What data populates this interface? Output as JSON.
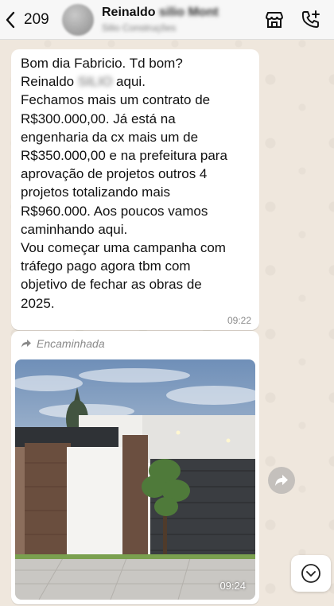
{
  "header": {
    "back_count": "209",
    "contact_name": "Reinaldo",
    "contact_name_hidden": "silio Mont",
    "contact_subtitle_hidden": "Silio Construções",
    "icons": [
      "chevron-left-icon",
      "store-icon",
      "add-call-icon"
    ]
  },
  "message": {
    "lines": [
      "Bom dia Fabricio. Td bom?",
      "Reinaldo",
      "Fechamos mais um contrato de",
      "R$300.000,00. Já está na",
      "engenharia da cx mais um de",
      "R$350.000,00 e na prefeitura para",
      "aprovação de projetos outros 4",
      "projetos totalizando mais",
      "R$960.000. Aos poucos vamos",
      "caminhando aqui.",
      "Vou começar uma campanha com",
      "tráfego pago agora tbm com",
      "objetivo de fechar as obras de",
      "2025."
    ],
    "line2_hidden": "SILIO",
    "line2_suffix": "aqui.",
    "time": "09:22"
  },
  "media_message": {
    "forwarded_label": "Encaminhada",
    "time": "09:24",
    "image_description_icon": "house-render-image"
  },
  "colors": {
    "wallpaper": "#efe7dd",
    "bubble": "#ffffff",
    "header": "#f7f7f7",
    "timestamp": "#8a8a8a"
  }
}
